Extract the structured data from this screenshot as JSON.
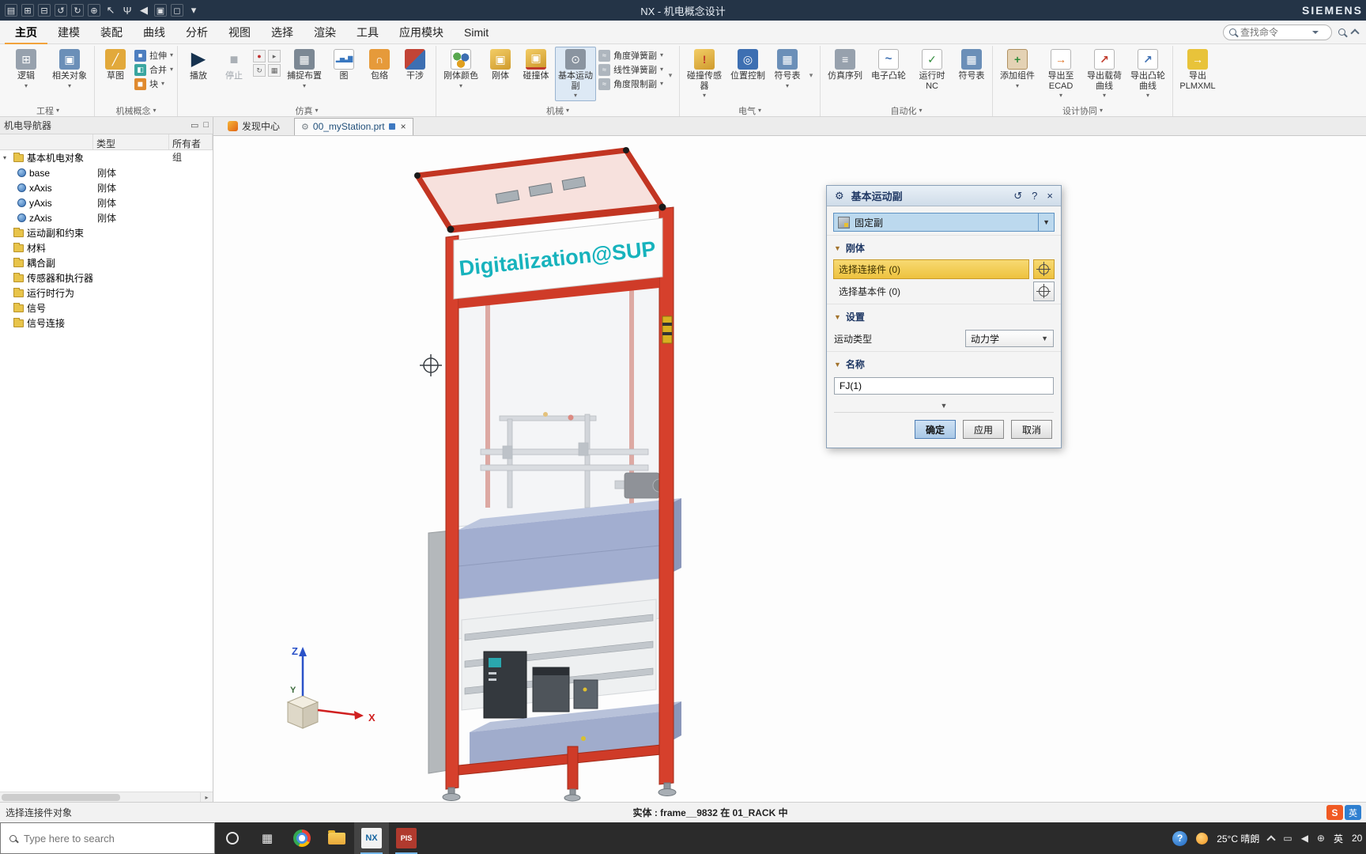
{
  "titlebar": {
    "title": "NX - 机电概念设计",
    "brand": "SIEMENS"
  },
  "menu": {
    "tabs": [
      "主页",
      "建模",
      "装配",
      "曲线",
      "分析",
      "视图",
      "选择",
      "渲染",
      "工具",
      "应用模块",
      "Simit"
    ],
    "search_placeholder": "查找命令"
  },
  "ribbon": {
    "groups": [
      {
        "label": "工程",
        "items": [
          "逻辑",
          "相关对象"
        ]
      },
      {
        "label": "机械概念",
        "items": [
          "草图",
          "拉伸",
          "合并",
          "块"
        ]
      },
      {
        "label": "仿真",
        "items": [
          "播放",
          "停止",
          "捕捉布置",
          "图",
          "包络",
          "干涉"
        ]
      },
      {
        "label": "机械",
        "items": [
          "刚体颜色",
          "刚体",
          "碰撞体",
          "基本运动副",
          "角度弹簧副",
          "线性弹簧副",
          "角度限制副"
        ]
      },
      {
        "label": "电气",
        "items": [
          "碰撞传感器",
          "位置控制",
          "符号表"
        ]
      },
      {
        "label": "自动化",
        "items": [
          "仿真序列",
          "电子凸轮",
          "运行时 NC",
          "符号表"
        ]
      },
      {
        "label": "设计协同",
        "items": [
          "添加组件",
          "导出至 ECAD",
          "导出载荷曲线",
          "导出凸轮曲线"
        ]
      },
      {
        "label": "",
        "items": [
          "导出 PLMXML"
        ]
      }
    ]
  },
  "navigator": {
    "title": "机电导航器",
    "columns": {
      "name": "",
      "type": "类型",
      "owner": "所有者组"
    },
    "rows": [
      {
        "label": "基本机电对象",
        "type": ""
      },
      {
        "label": "base",
        "type": "刚体"
      },
      {
        "label": "xAxis",
        "type": "刚体"
      },
      {
        "label": "yAxis",
        "type": "刚体"
      },
      {
        "label": "zAxis",
        "type": "刚体"
      },
      {
        "label": "运动副和约束",
        "type": ""
      },
      {
        "label": "材料",
        "type": ""
      },
      {
        "label": "耦合副",
        "type": ""
      },
      {
        "label": "传感器和执行器",
        "type": ""
      },
      {
        "label": "运行时行为",
        "type": ""
      },
      {
        "label": "信号",
        "type": ""
      },
      {
        "label": "信号连接",
        "type": ""
      }
    ]
  },
  "doc_tabs": {
    "discovery": "发现中心",
    "part": "00_myStation.prt"
  },
  "viewport": {
    "sign": "Digitalization@SUP",
    "axis_x": "X",
    "axis_y": "Y",
    "axis_z": "Z"
  },
  "dialog": {
    "title": "基本运动副",
    "type_value": "固定副",
    "rigid_section": "刚体",
    "select_attach": "选择连接件 (0)",
    "select_base": "选择基本件 (0)",
    "settings_section": "设置",
    "motion_label": "运动类型",
    "motion_value": "动力学",
    "name_section": "名称",
    "name_value": "FJ(1)",
    "ok": "确定",
    "apply": "应用",
    "cancel": "取消"
  },
  "statusbar": {
    "prompt": "选择连接件对象",
    "entity": "实体 : frame__9832 在 01_RACK 中"
  },
  "taskbar": {
    "search_placeholder": "Type here to search",
    "weather": "25°C 晴朗",
    "lang": "英",
    "time": "20",
    "ime_logo": "S",
    "ime_mode": "英"
  },
  "icons": {
    "gear-icon": "⚙",
    "reset-icon": "↺",
    "help-icon": "?",
    "close-icon": "×",
    "section-arrow-icon": "▼",
    "caret-icon": "▾",
    "play-icon": "▶",
    "stop-icon": "■",
    "mic-icon": "Ψ",
    "cursor-icon": "↖",
    "search-icon": "magnifier-css-shape"
  },
  "colors": {
    "titlebar": "#243447",
    "accent_orange": "#f2a33c",
    "frame_red": "#d6402c",
    "sign_teal": "#17b3bd",
    "highlight_amber": "#eec23f",
    "selection_blue": "#bcd9ee"
  }
}
